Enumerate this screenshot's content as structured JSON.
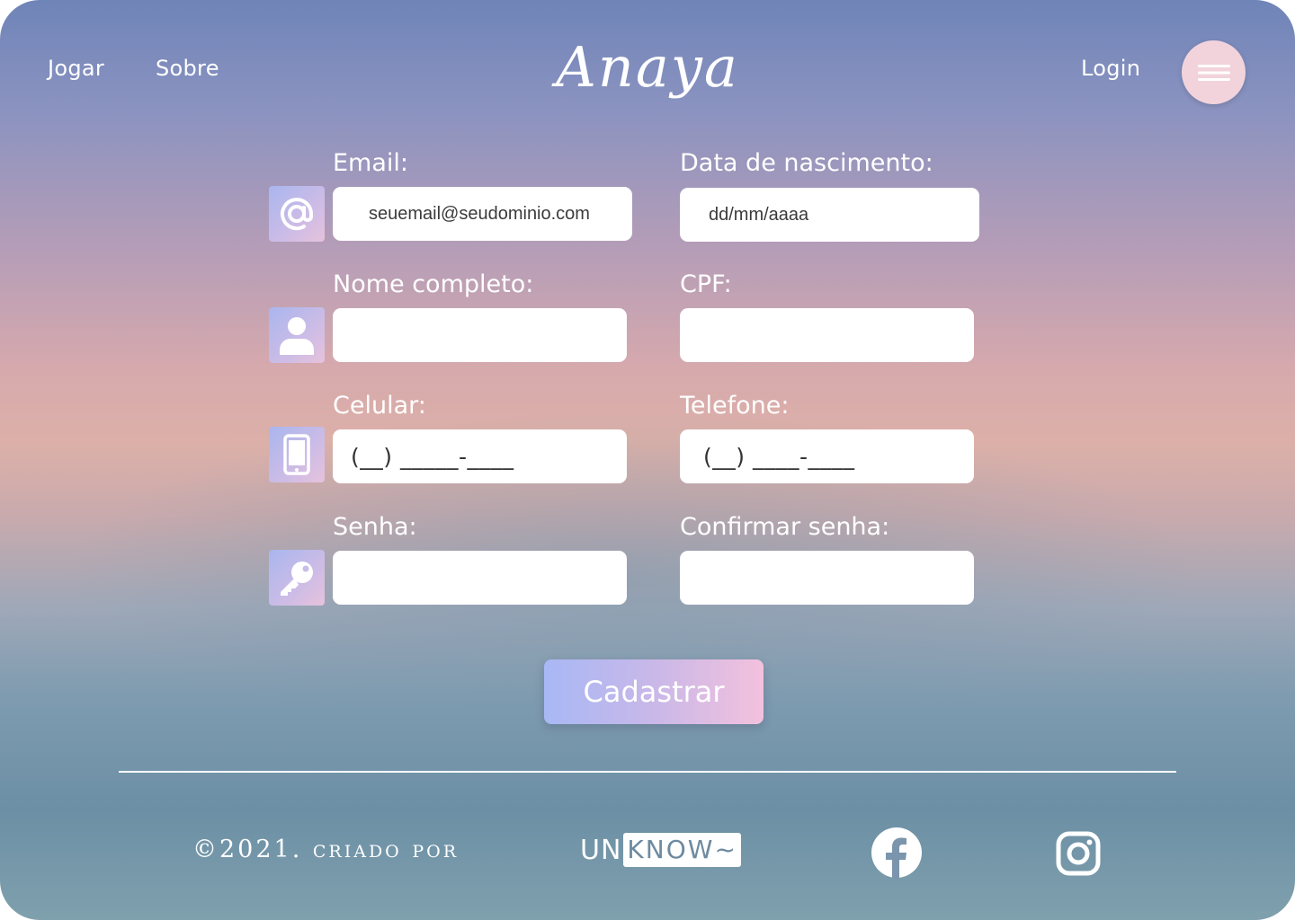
{
  "header": {
    "nav": [
      "Jogar",
      "Sobre"
    ],
    "brand": "Anaya",
    "login": "Login"
  },
  "form": {
    "email": {
      "label": "Email:",
      "placeholder": "seuemail@seudominio.com"
    },
    "birth_date": {
      "label": "Data de  nascimento:",
      "placeholder": "dd/mm/aaaa"
    },
    "full_name": {
      "label": "Nome completo:"
    },
    "cpf": {
      "label": "CPF:"
    },
    "mobile": {
      "label": "Celular:",
      "mask": "(__) _____-____"
    },
    "phone": {
      "label": "Telefone:",
      "mask": "(__) ____-____"
    },
    "password": {
      "label": "Senha:"
    },
    "confirm_password": {
      "label": "Confirmar senha:"
    },
    "submit_label": "Cadastrar"
  },
  "footer": {
    "copyright": "©2021. criado por",
    "logo_prefix": "UN",
    "logo_boxed": "KNOW~"
  },
  "icons": {
    "email": "at-sign-icon",
    "name": "user-icon",
    "mobile": "smartphone-icon",
    "password": "key-icon",
    "menu": "hamburger-menu-icon",
    "facebook": "facebook-icon",
    "instagram": "instagram-icon"
  },
  "colors": {
    "menu_button": "#f2d3dc",
    "submit_gradient_start": "#a8b8f5",
    "submit_gradient_end": "#f3c1dd",
    "icon_tile": "#b8bcec"
  }
}
